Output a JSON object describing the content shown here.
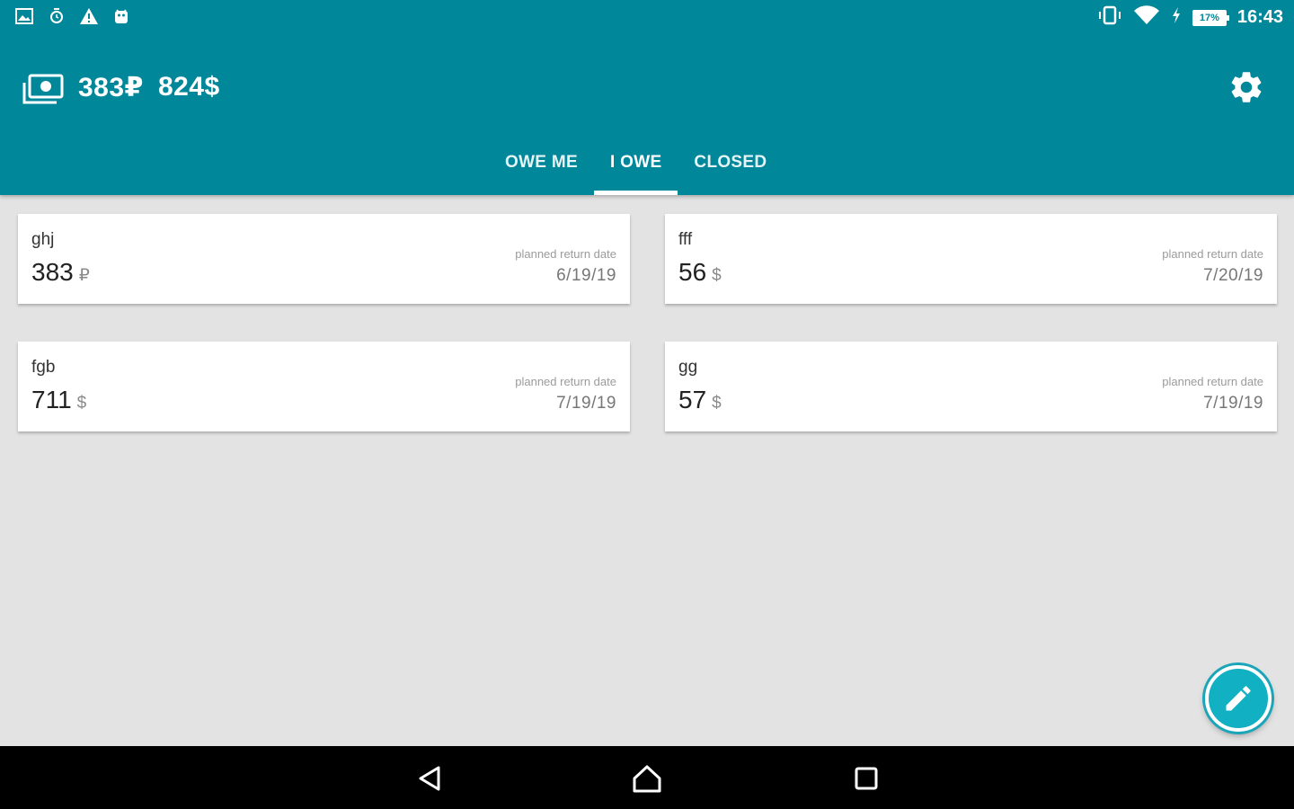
{
  "statusbar": {
    "left_icons": [
      "image-icon",
      "alarm-icon",
      "warning-icon",
      "android-icon"
    ],
    "battery_percent": "17%",
    "time": "16:43"
  },
  "header": {
    "totals": [
      "383₽",
      "824$"
    ],
    "app_icon": "money-icon",
    "settings_icon": "gear-icon"
  },
  "tabs": [
    {
      "label": "OWE ME",
      "active": false
    },
    {
      "label": "I OWE",
      "active": true
    },
    {
      "label": "CLOSED",
      "active": false
    }
  ],
  "debts": [
    {
      "name": "ghj",
      "amount": "383",
      "currency": "₽",
      "return_label": "planned return date",
      "date": "6/19/19"
    },
    {
      "name": "fff",
      "amount": "56",
      "currency": "$",
      "return_label": "planned return date",
      "date": "7/20/19"
    },
    {
      "name": "fgb",
      "amount": "711",
      "currency": "$",
      "return_label": "planned return date",
      "date": "7/19/19"
    },
    {
      "name": "gg",
      "amount": "57",
      "currency": "$",
      "return_label": "planned return date",
      "date": "7/19/19"
    }
  ],
  "colors": {
    "primary": "#00879a",
    "accent": "#12b0c3",
    "background": "#e3e3e3"
  },
  "fab": {
    "icon": "pencil-icon"
  },
  "navbar": {
    "icons": [
      "back-icon",
      "home-icon",
      "recents-icon"
    ]
  }
}
